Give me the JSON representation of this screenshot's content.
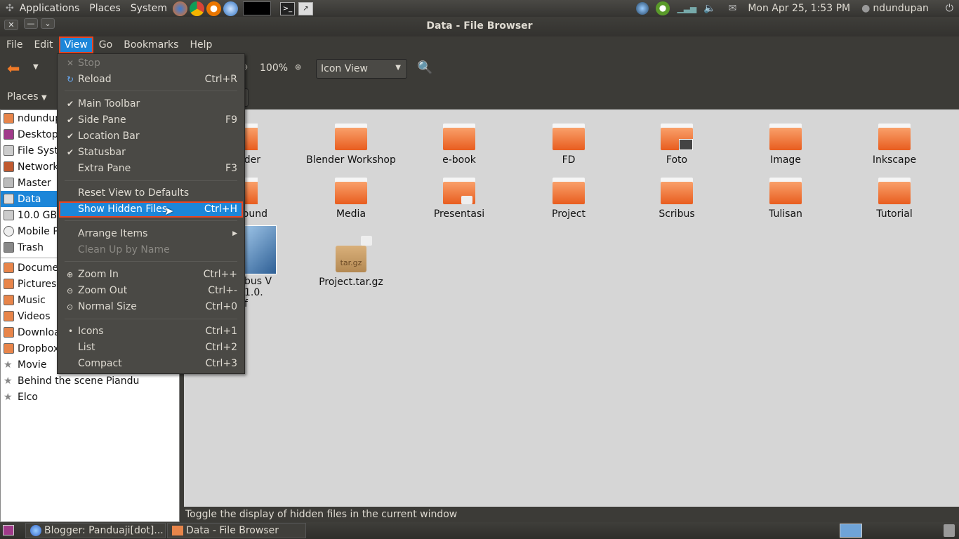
{
  "top_panel": {
    "menus": [
      "Applications",
      "Places",
      "System"
    ],
    "clock": "Mon Apr 25,  1:53 PM",
    "user": "ndundupan"
  },
  "window": {
    "title": "Data - File Browser"
  },
  "menubar": {
    "file": "File",
    "edit": "Edit",
    "view": "View",
    "go": "Go",
    "bookmarks": "Bookmarks",
    "help": "Help"
  },
  "toolbar": {
    "zoom": "100%",
    "view_mode": "Icon View"
  },
  "sidebar": {
    "header": "Places",
    "places": [
      "ndundupan",
      "Desktop",
      "File System",
      "Network",
      "Master",
      "Data",
      "10.0 GB Media",
      "Mobile Pa",
      "Trash"
    ],
    "bookmarks": [
      "Documents",
      "Pictures",
      "Music",
      "Videos",
      "Downloads",
      "Dropbox",
      "Movie",
      "Behind the scene Piandu",
      "Elco"
    ]
  },
  "files": {
    "row1": [
      "der",
      "Blender Workshop",
      "e-book",
      "FD",
      "Foto",
      "Image",
      "Inkscape"
    ],
    "row2": [
      "ound",
      "Media",
      "Presentasi",
      "Project",
      "Scribus",
      "Tulisan",
      "Tutorial"
    ],
    "row3_doc": "bus V 1.0.",
    "row3_doc2": "f",
    "archive": "Project.tar.gz",
    "archive_badge": "tar.gz"
  },
  "view_menu": {
    "stop": "Stop",
    "reload": "Reload",
    "reload_acc": "Ctrl+R",
    "main_toolbar": "Main Toolbar",
    "side_pane": "Side Pane",
    "side_pane_acc": "F9",
    "location_bar": "Location Bar",
    "statusbar": "Statusbar",
    "extra_pane": "Extra Pane",
    "extra_pane_acc": "F3",
    "reset_view": "Reset View to Defaults",
    "show_hidden": "Show Hidden Files",
    "show_hidden_acc": "Ctrl+H",
    "arrange_items": "Arrange Items",
    "clean_up": "Clean Up by Name",
    "zoom_in": "Zoom In",
    "zoom_in_acc": "Ctrl++",
    "zoom_out": "Zoom Out",
    "zoom_out_acc": "Ctrl+-",
    "normal_size": "Normal Size",
    "normal_size_acc": "Ctrl+0",
    "icons": "Icons",
    "icons_acc": "Ctrl+1",
    "list": "List",
    "list_acc": "Ctrl+2",
    "compact": "Compact",
    "compact_acc": "Ctrl+3"
  },
  "statusbar": {
    "text": "Toggle the display of hidden files in the current window"
  },
  "taskbar": {
    "task1": "Blogger: Panduaji[dot]...",
    "task2": "Data - File Browser"
  },
  "colors": {
    "accent": "#1c86d9",
    "highlight_border": "#e84624",
    "folder": "#ec6b2d"
  }
}
